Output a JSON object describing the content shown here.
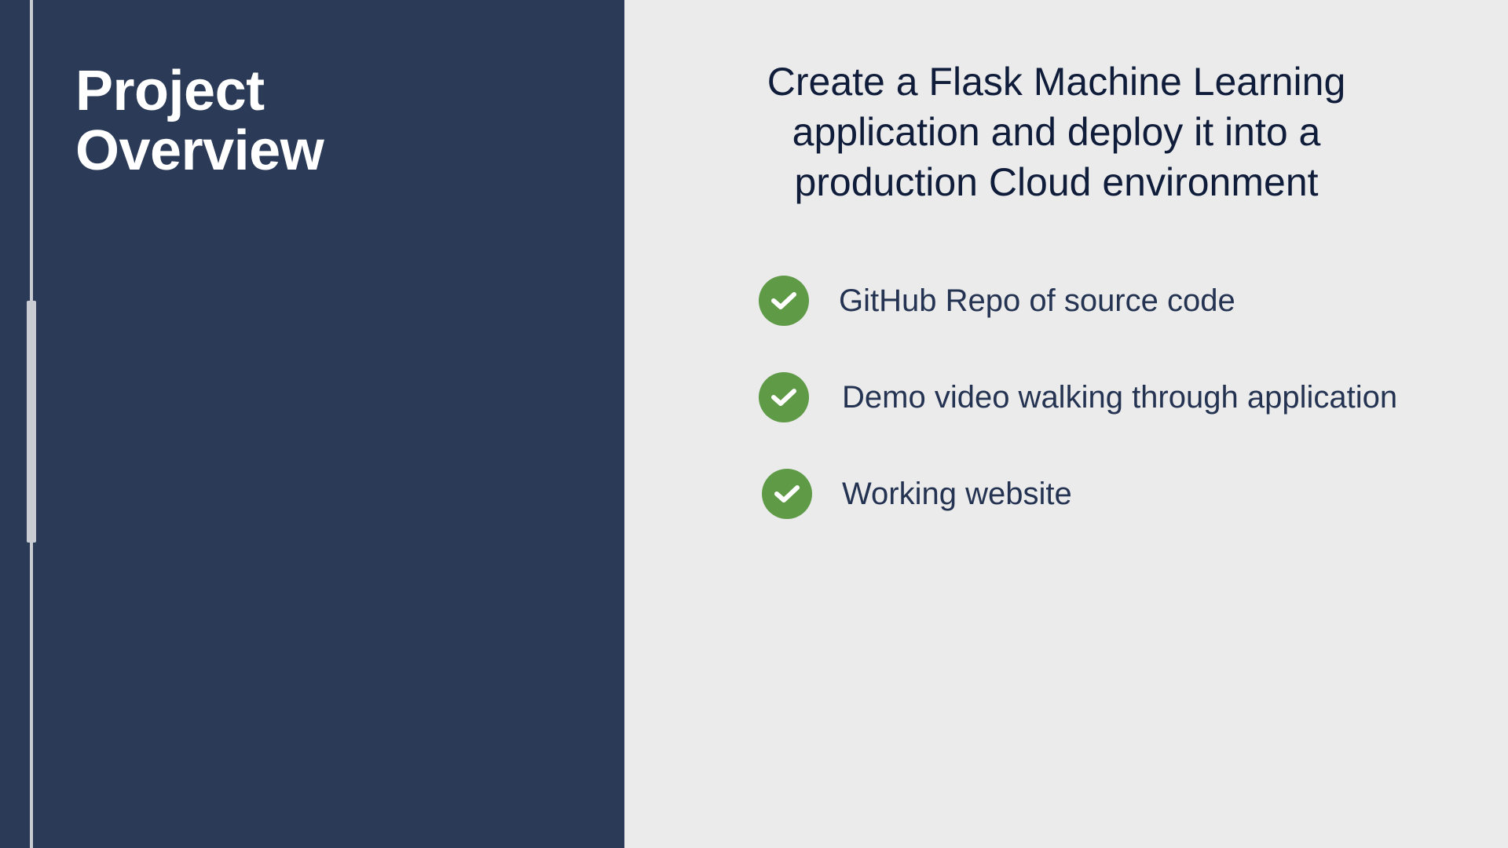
{
  "left_panel": {
    "title": "Project\nOverview"
  },
  "main": {
    "headline": "Create a Flask Machine Learning\napplication and deploy it into a\nproduction Cloud environment",
    "checklist": [
      {
        "label": "GitHub Repo of source code",
        "icon": "check-circle-icon"
      },
      {
        "label": "Demo video walking through application",
        "icon": "check-circle-icon"
      },
      {
        "label": "Working website",
        "icon": "check-circle-icon"
      }
    ]
  },
  "colors": {
    "left_panel_bg": "#2b3a57",
    "content_bg": "#ebebeb",
    "check_green": "#5f9a47",
    "headline_text": "#0f1c3a",
    "item_text": "#243352"
  }
}
